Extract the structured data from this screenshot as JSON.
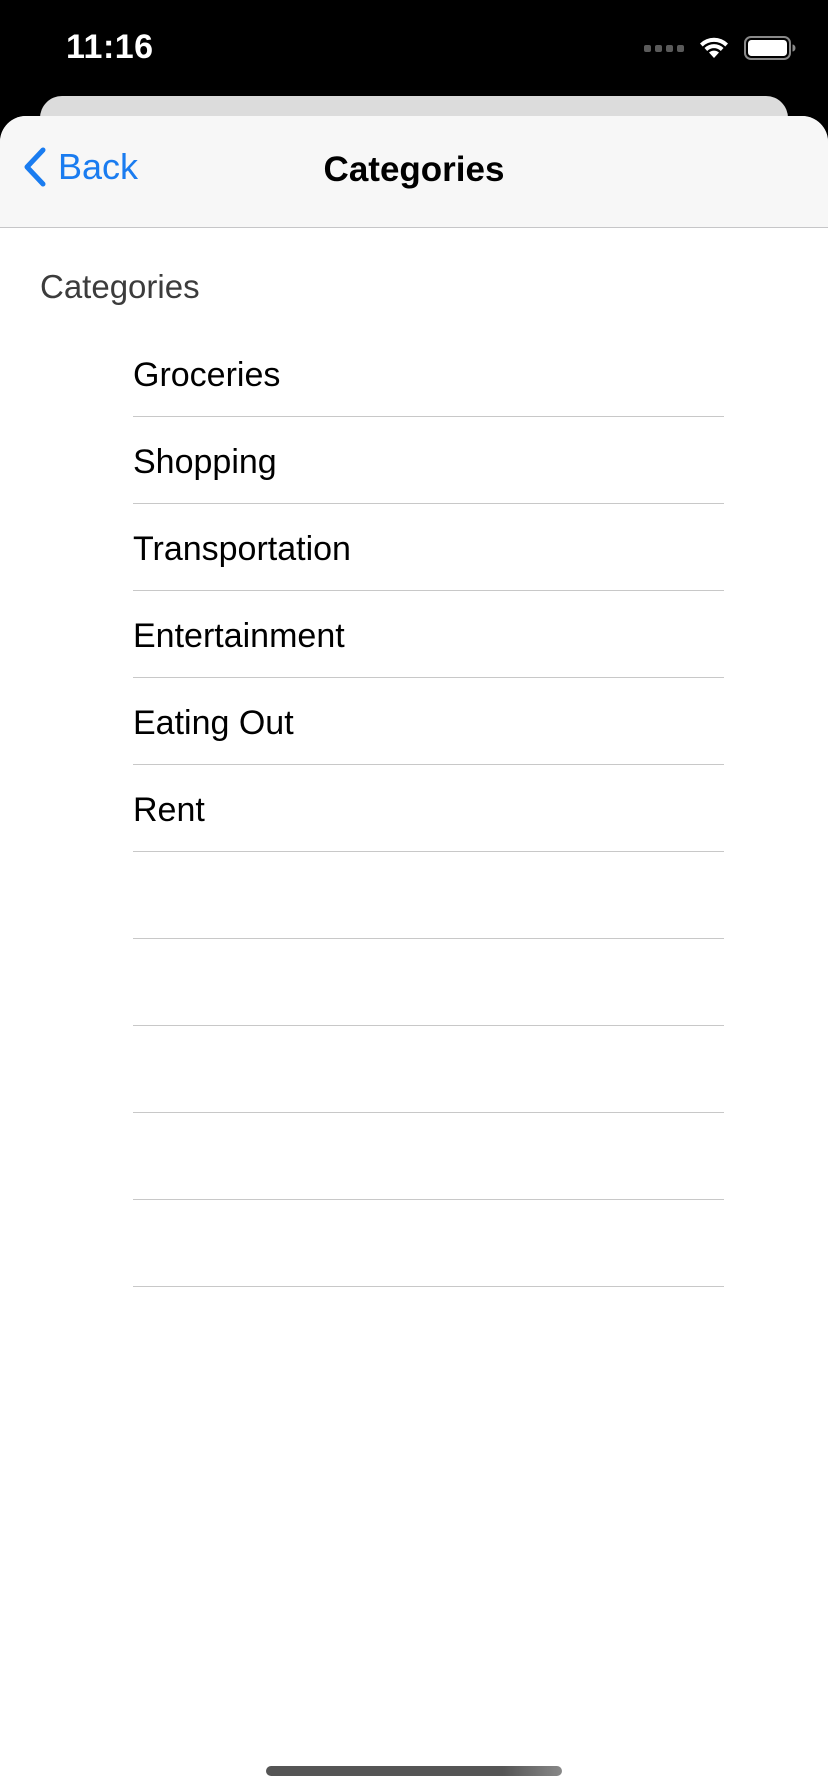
{
  "status_bar": {
    "time": "11:16"
  },
  "nav": {
    "back_label": "Back",
    "title": "Categories"
  },
  "section": {
    "header": "Categories"
  },
  "categories": [
    {
      "label": "Groceries"
    },
    {
      "label": "Shopping"
    },
    {
      "label": "Transportation"
    },
    {
      "label": "Entertainment"
    },
    {
      "label": "Eating Out"
    },
    {
      "label": "Rent"
    },
    {
      "label": ""
    },
    {
      "label": ""
    },
    {
      "label": ""
    },
    {
      "label": ""
    },
    {
      "label": ""
    }
  ],
  "colors": {
    "accent": "#1a7cf0",
    "nav_background": "#f7f7f7",
    "separator": "#c8c8c8"
  },
  "icons": {
    "back": "chevron-left-icon",
    "signal": "signal-icon",
    "wifi": "wifi-icon",
    "battery": "battery-icon"
  }
}
